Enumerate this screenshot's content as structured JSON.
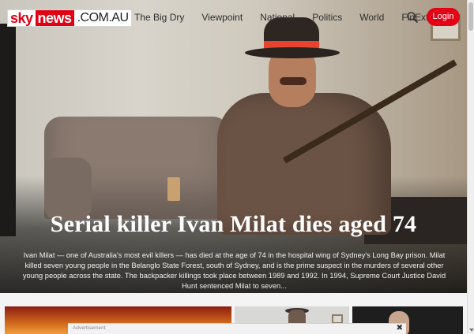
{
  "logo": {
    "sky": "sky",
    "news": "news",
    "domain": ".COM.AU"
  },
  "nav": {
    "items": [
      "The Big Dry",
      "Viewpoint",
      "National",
      "Politics",
      "World"
    ],
    "finextra_label": "FinExtra"
  },
  "header": {
    "login_label": "Login"
  },
  "hero": {
    "headline": "Serial killer Ivan Milat dies aged 74",
    "summary": "Ivan Milat — one of Australia's most evil killers — has died at the age of 74 in the hospital wing of Sydney's Long Bay prison. Milat killed seven young people in the Belanglo State Forest, south of Sydney, and is the prime suspect in the murders of several other young people across the state. The backpacker killings took place between 1989 and 1992. In 1994, Supreme Court Justice David Hunt sentenced Milat to seven..."
  },
  "ad": {
    "label": "Advertisement",
    "close_glyph": "✖"
  },
  "colors": {
    "brand_red": "#e20014"
  },
  "icons": {
    "search": "search-icon",
    "caret": "caret-down-icon",
    "close": "close-icon"
  }
}
